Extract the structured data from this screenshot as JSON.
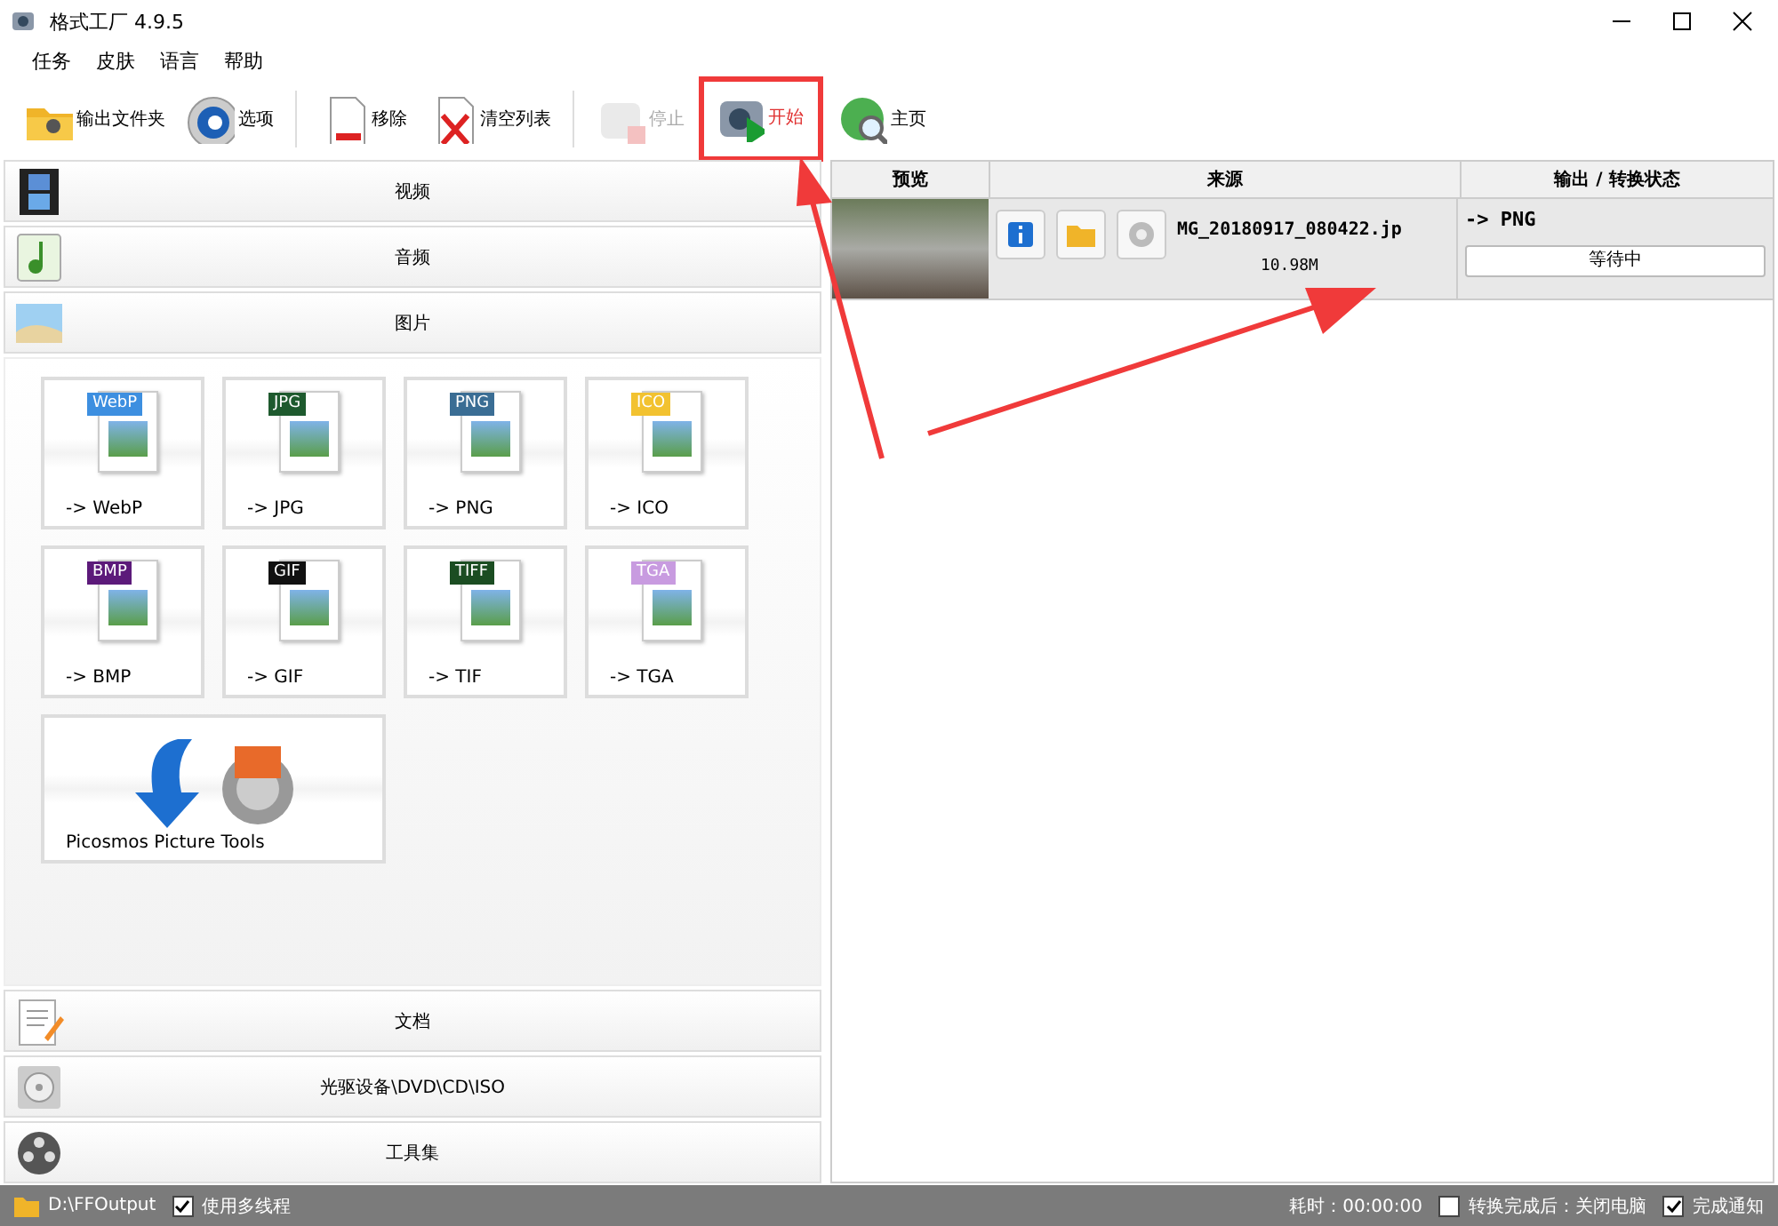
{
  "window": {
    "title": "格式工厂 4.9.5"
  },
  "menu": [
    "任务",
    "皮肤",
    "语言",
    "帮助"
  ],
  "toolbar": [
    {
      "kind": "folder",
      "label": "输出文件夹",
      "disabled": false
    },
    {
      "kind": "gear",
      "label": "选项",
      "disabled": false
    },
    {
      "kind": "sep"
    },
    {
      "kind": "remove",
      "label": "移除",
      "disabled": false
    },
    {
      "kind": "clear",
      "label": "清空列表",
      "disabled": false
    },
    {
      "kind": "sep"
    },
    {
      "kind": "stop",
      "label": "停止",
      "disabled": true
    },
    {
      "kind": "start",
      "label": "开始",
      "disabled": false,
      "highlighted": true
    },
    {
      "kind": "home",
      "label": "主页",
      "disabled": false
    }
  ],
  "categories_top": [
    {
      "kind": "video",
      "label": "视频"
    },
    {
      "kind": "audio",
      "label": "音频"
    },
    {
      "kind": "picture",
      "label": "图片",
      "tiles": [
        {
          "kind": "format",
          "badge": "WebP",
          "label": "-> WebP",
          "color": "#3d8fe0"
        },
        {
          "kind": "format",
          "badge": "JPG",
          "label": "-> JPG",
          "color": "#1e5a2e"
        },
        {
          "kind": "format",
          "badge": "PNG",
          "label": "-> PNG",
          "color": "#3a6d94"
        },
        {
          "kind": "format",
          "badge": "ICO",
          "label": "-> ICO",
          "color": "#f2c230"
        },
        {
          "kind": "format",
          "badge": "BMP",
          "label": "-> BMP",
          "color": "#5c1a7a"
        },
        {
          "kind": "format",
          "badge": "GIF",
          "label": "-> GIF",
          "color": "#111111"
        },
        {
          "kind": "format",
          "badge": "TIFF",
          "label": "-> TIF",
          "color": "#1b4d22"
        },
        {
          "kind": "format",
          "badge": "TGA",
          "label": "-> TGA",
          "color": "#c89be0"
        },
        {
          "kind": "tool",
          "label": "Picosmos Picture Tools"
        }
      ]
    }
  ],
  "categories_bottom": [
    {
      "kind": "document",
      "label": "文档"
    },
    {
      "kind": "disc",
      "label": "光驱设备\\DVD\\CD\\ISO"
    },
    {
      "kind": "tools",
      "label": "工具集"
    }
  ],
  "table": {
    "columns": [
      "预览",
      "来源",
      "输出 / 转换状态"
    ],
    "rows": [
      {
        "file": "MG_20180917_080422.jp",
        "size": "10.98M",
        "output": "-> PNG",
        "status": "等待中",
        "selected": false
      }
    ]
  },
  "status_bar": {
    "path": "D:\\FFOutput",
    "options": [
      {
        "label": "使用多线程",
        "checked": true
      }
    ],
    "elapsed": "耗时：00:00:00",
    "right_options": [
      {
        "label": "转换完成后：关闭电脑",
        "checked": false
      },
      {
        "label": "完成通知",
        "checked": true
      }
    ]
  }
}
